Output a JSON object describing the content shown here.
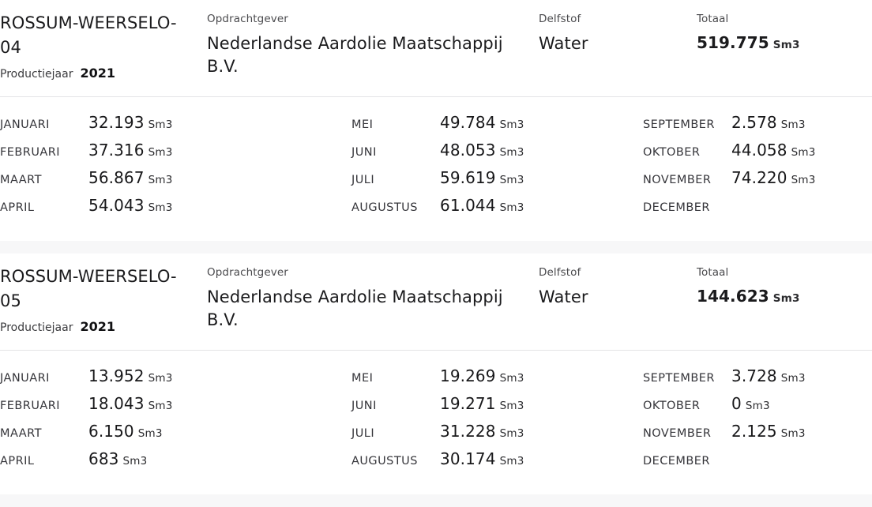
{
  "labels": {
    "client": "Opdrachtgever",
    "mineral": "Delfstof",
    "total": "Totaal",
    "production_year": "Productiejaar",
    "unit": "Sm3"
  },
  "cards": [
    {
      "well_name": "ROSSUM-WEERSELO-04",
      "production_year": "2021",
      "client": "Nederlandse Aardolie Maatschappij B.V.",
      "mineral": "Water",
      "total": "519.775",
      "total_unit": "Sm3",
      "months": [
        {
          "name": "JANUARI",
          "value": "32.193",
          "unit": "Sm3"
        },
        {
          "name": "FEBRUARI",
          "value": "37.316",
          "unit": "Sm3"
        },
        {
          "name": "MAART",
          "value": "56.867",
          "unit": "Sm3"
        },
        {
          "name": "APRIL",
          "value": "54.043",
          "unit": "Sm3"
        },
        {
          "name": "MEI",
          "value": "49.784",
          "unit": "Sm3"
        },
        {
          "name": "JUNI",
          "value": "48.053",
          "unit": "Sm3"
        },
        {
          "name": "JULI",
          "value": "59.619",
          "unit": "Sm3"
        },
        {
          "name": "AUGUSTUS",
          "value": "61.044",
          "unit": "Sm3"
        },
        {
          "name": "SEPTEMBER",
          "value": "2.578",
          "unit": "Sm3"
        },
        {
          "name": "OKTOBER",
          "value": "44.058",
          "unit": "Sm3"
        },
        {
          "name": "NOVEMBER",
          "value": "74.220",
          "unit": "Sm3"
        },
        {
          "name": "DECEMBER",
          "value": "",
          "unit": ""
        }
      ]
    },
    {
      "well_name": "ROSSUM-WEERSELO-05",
      "production_year": "2021",
      "client": "Nederlandse Aardolie Maatschappij B.V.",
      "mineral": "Water",
      "total": "144.623",
      "total_unit": "Sm3",
      "months": [
        {
          "name": "JANUARI",
          "value": "13.952",
          "unit": "Sm3"
        },
        {
          "name": "FEBRUARI",
          "value": "18.043",
          "unit": "Sm3"
        },
        {
          "name": "MAART",
          "value": "6.150",
          "unit": "Sm3"
        },
        {
          "name": "APRIL",
          "value": "683",
          "unit": "Sm3"
        },
        {
          "name": "MEI",
          "value": "19.269",
          "unit": "Sm3"
        },
        {
          "name": "JUNI",
          "value": "19.271",
          "unit": "Sm3"
        },
        {
          "name": "JULI",
          "value": "31.228",
          "unit": "Sm3"
        },
        {
          "name": "AUGUSTUS",
          "value": "30.174",
          "unit": "Sm3"
        },
        {
          "name": "SEPTEMBER",
          "value": "3.728",
          "unit": "Sm3"
        },
        {
          "name": "OKTOBER",
          "value": "0",
          "unit": "Sm3"
        },
        {
          "name": "NOVEMBER",
          "value": "2.125",
          "unit": "Sm3"
        },
        {
          "name": "DECEMBER",
          "value": "",
          "unit": ""
        }
      ]
    }
  ],
  "colors": {
    "page_background": "#f4f4f5",
    "card_background": "#ffffff",
    "divider": "#e4e4e6",
    "text_primary": "#18181a",
    "text_secondary": "#4a4a4d"
  }
}
